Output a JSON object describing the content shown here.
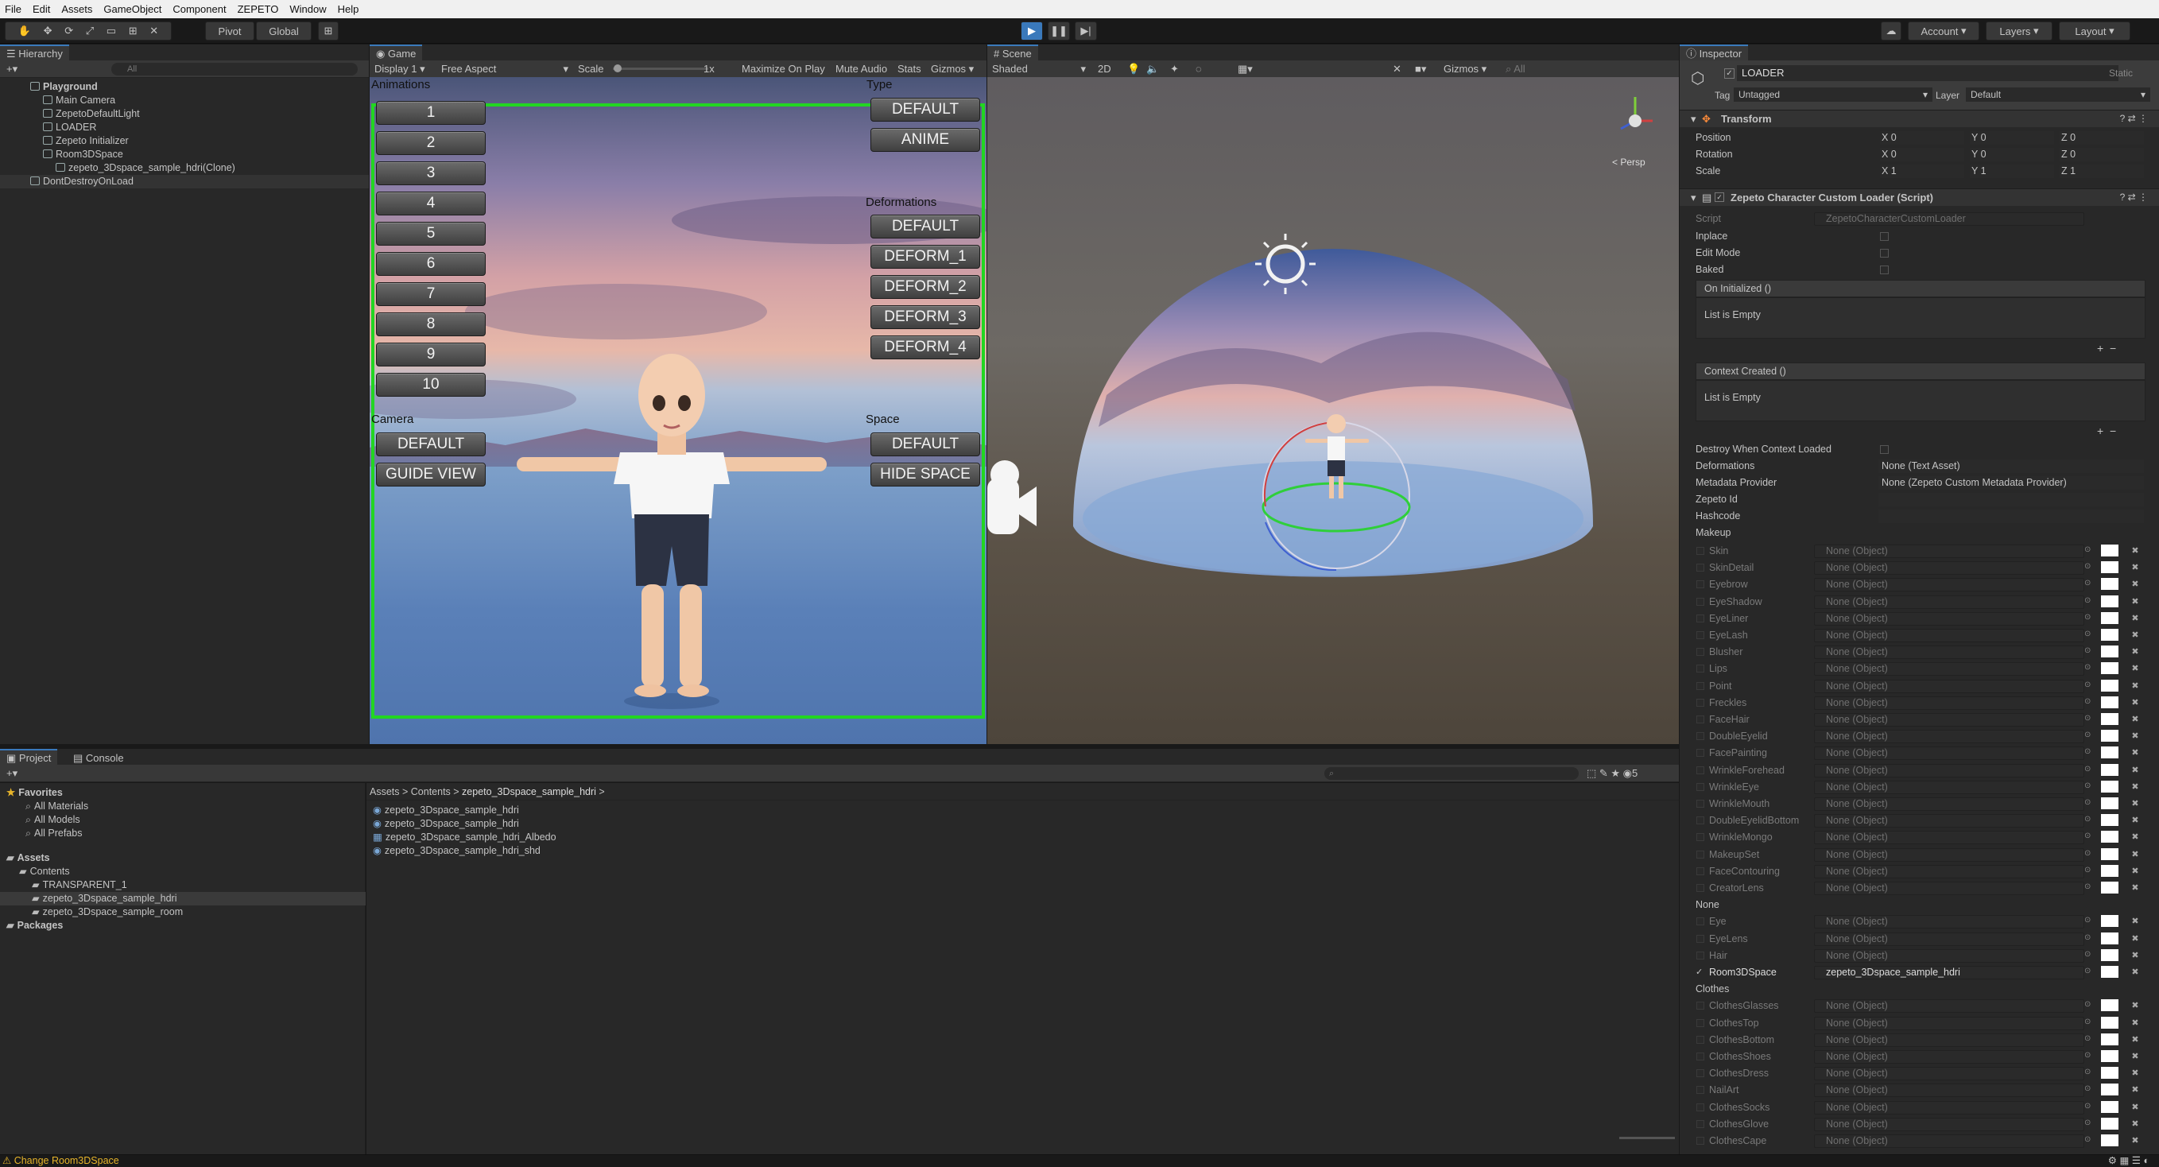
{
  "menu": [
    "File",
    "Edit",
    "Assets",
    "GameObject",
    "Component",
    "ZEPETO",
    "Window",
    "Help"
  ],
  "toolbar": {
    "pivot": "Pivot",
    "global": "Global",
    "account": "Account",
    "layers": "Layers",
    "layout": "Layout"
  },
  "hierarchy": {
    "tab": "Hierarchy",
    "search": "All",
    "items": [
      {
        "label": "Playground",
        "indent": 0,
        "bold": true
      },
      {
        "label": "Main Camera",
        "indent": 1
      },
      {
        "label": "ZepetoDefaultLight",
        "indent": 1
      },
      {
        "label": "LOADER",
        "indent": 1
      },
      {
        "label": "Zepeto Initializer",
        "indent": 1
      },
      {
        "label": "Room3DSpace",
        "indent": 1
      },
      {
        "label": "zepeto_3Dspace_sample_hdri(Clone)",
        "indent": 2
      },
      {
        "label": "DontDestroyOnLoad",
        "indent": 0
      }
    ]
  },
  "game": {
    "tab": "Game",
    "display": "Display 1",
    "aspect": "Free Aspect",
    "scale_label": "Scale",
    "scale_value": "1x",
    "maximize": "Maximize On Play",
    "mute": "Mute Audio",
    "stats": "Stats",
    "gizmos": "Gizmos",
    "animations_label": "Animations",
    "animation_buttons": [
      "1",
      "2",
      "3",
      "4",
      "5",
      "6",
      "7",
      "8",
      "9",
      "10"
    ],
    "type_label": "Type",
    "type_buttons": [
      "DEFAULT",
      "ANIME"
    ],
    "deformations_label": "Deformations",
    "deformation_buttons": [
      "DEFAULT",
      "DEFORM_1",
      "DEFORM_2",
      "DEFORM_3",
      "DEFORM_4"
    ],
    "camera_label": "Camera",
    "camera_buttons": [
      "DEFAULT",
      "GUIDE VIEW"
    ],
    "space_label": "Space",
    "space_buttons": [
      "DEFAULT",
      "HIDE SPACE"
    ]
  },
  "scene": {
    "tab": "Scene",
    "shading": "Shaded",
    "mode2d": "2D",
    "gizmos": "Gizmos",
    "search": "All",
    "persp": "< Persp"
  },
  "project": {
    "tabs": [
      "Project",
      "Console"
    ],
    "breadcrumb": [
      "Assets",
      "Contents",
      "zepeto_3Dspace_sample_hdri"
    ],
    "favorites": [
      "Favorites",
      "All Materials",
      "All Models",
      "All Prefabs"
    ],
    "tree": [
      "Assets",
      "Contents",
      "TRANSPARENT_1",
      "zepeto_3Dspace_sample_hdri",
      "zepeto_3Dspace_sample_room",
      "Packages"
    ],
    "files": [
      "zepeto_3Dspace_sample_hdri",
      "zepeto_3Dspace_sample_hdri",
      "zepeto_3Dspace_sample_hdri_Albedo",
      "zepeto_3Dspace_sample_hdri_shd"
    ]
  },
  "inspector": {
    "tab": "Inspector",
    "object": "LOADER",
    "static": "Static",
    "tag_label": "Tag",
    "tag": "Untagged",
    "layer_label": "Layer",
    "layer": "Default",
    "transform": "Transform",
    "pos": "Position",
    "rot": "Rotation",
    "scl": "Scale",
    "pos_v": [
      "X 0",
      "Y 0",
      "Z 0"
    ],
    "rot_v": [
      "X 0",
      "Y 0",
      "Z 0"
    ],
    "scl_v": [
      "X 1",
      "Y 1",
      "Z 1"
    ],
    "script_title": "Zepeto Character Custom Loader (Script)",
    "script_label": "Script",
    "script_value": "ZepetoCharacterCustomLoader",
    "flags": [
      "Inplace",
      "Edit Mode",
      "Baked"
    ],
    "on_init": "On Initialized ()",
    "list_empty": "List is Empty",
    "context_created": "Context Created ()",
    "destroy_label": "Destroy When Context Loaded",
    "deformations_label": "Deformations",
    "deformations_value": "None (Text Asset)",
    "metadata_label": "Metadata Provider",
    "metadata_value": "None (Zepeto Custom Metadata Provider)",
    "zepeto_id": "Zepeto Id",
    "hashcode": "Hashcode",
    "makeup_header": "Makeup",
    "makeup": [
      "Skin",
      "SkinDetail",
      "Eyebrow",
      "EyeShadow",
      "EyeLiner",
      "EyeLash",
      "Blusher",
      "Lips",
      "Point",
      "Freckles",
      "FaceHair",
      "DoubleEyelid",
      "FacePainting",
      "WrinkleForehead",
      "WrinkleEye",
      "WrinkleMouth",
      "DoubleEyelidBottom",
      "WrinkleMongo",
      "MakeupSet",
      "FaceContouring",
      "CreatorLens"
    ],
    "none_header": "None",
    "none_items": [
      "Eye",
      "EyeLens",
      "Hair"
    ],
    "room_label": "Room3DSpace",
    "room_value": "zepeto_3Dspace_sample_hdri",
    "clothes_header": "Clothes",
    "clothes": [
      "ClothesGlasses",
      "ClothesTop",
      "ClothesBottom",
      "ClothesShoes",
      "ClothesDress",
      "NailArt",
      "ClothesSocks",
      "ClothesGlove",
      "ClothesCape"
    ],
    "none_object": "None (Object)"
  },
  "status": {
    "message": "Change Room3DSpace"
  }
}
